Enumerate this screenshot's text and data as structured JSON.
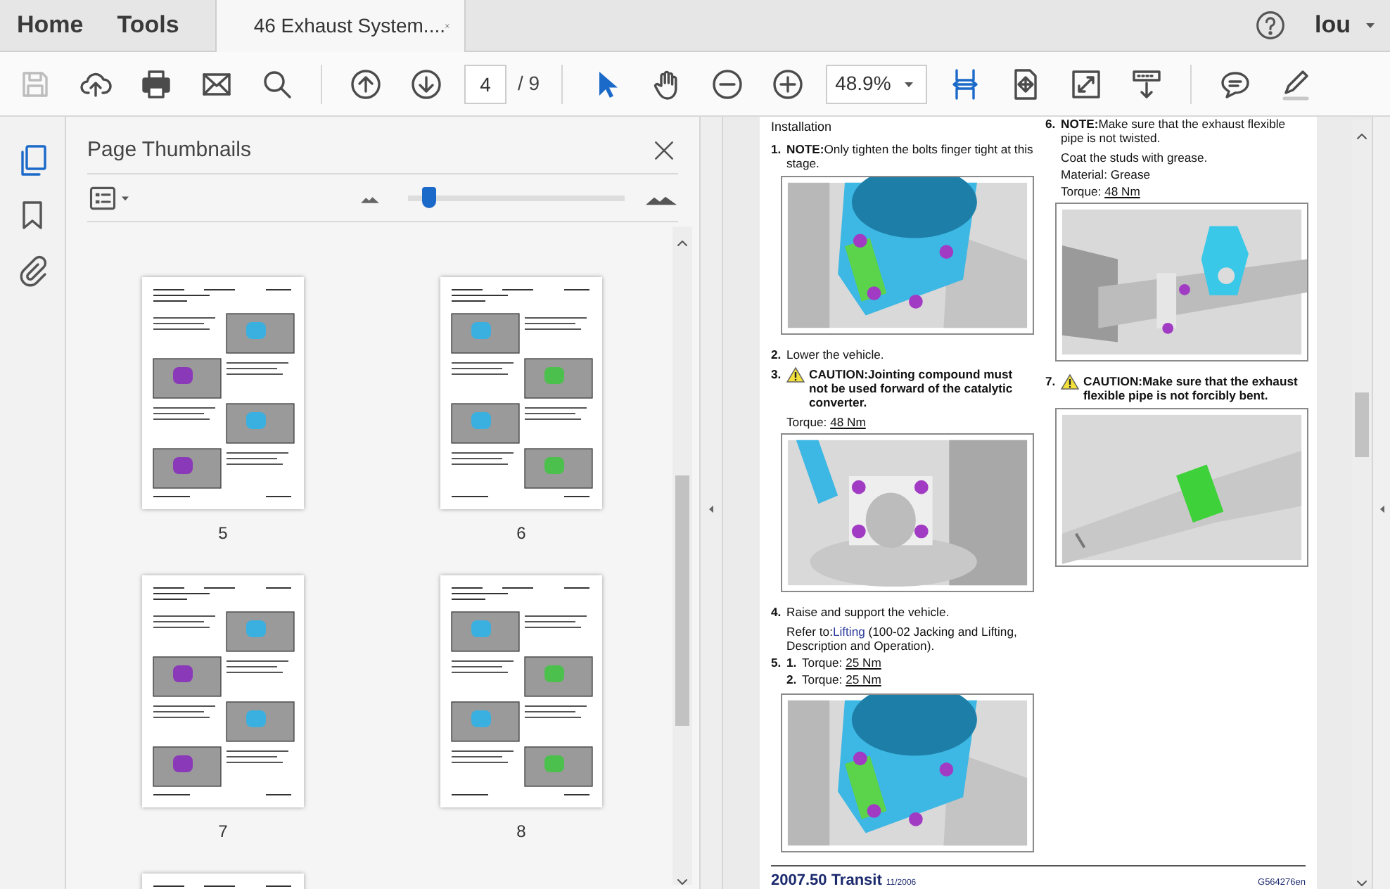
{
  "tabs": [
    {
      "label": "Home",
      "selected": false
    },
    {
      "label": "Tools",
      "selected": false
    },
    {
      "label": "46 Exhaust System....",
      "selected": true
    }
  ],
  "user": "lou",
  "toolbar": [
    {
      "kind": "save",
      "disabled": true,
      "selected": false
    },
    {
      "kind": "upload",
      "disabled": false,
      "selected": false
    },
    {
      "kind": "print",
      "disabled": false,
      "selected": false
    },
    {
      "kind": "mail",
      "disabled": false,
      "selected": false
    },
    {
      "kind": "search",
      "disabled": false,
      "selected": false
    },
    {
      "kind": "separator"
    },
    {
      "kind": "prev-page",
      "disabled": false,
      "selected": false
    },
    {
      "kind": "next-page",
      "disabled": false,
      "selected": false
    },
    {
      "kind": "page-field",
      "value": "4",
      "total": "/ 9"
    },
    {
      "kind": "separator"
    },
    {
      "kind": "select",
      "disabled": false,
      "selected": true
    },
    {
      "kind": "hand",
      "disabled": false,
      "selected": false
    },
    {
      "kind": "zoom-out",
      "disabled": false,
      "selected": false
    },
    {
      "kind": "zoom-in",
      "disabled": false,
      "selected": false
    },
    {
      "kind": "zoom-field",
      "value": "48.9%"
    },
    {
      "kind": "fit-width",
      "disabled": false,
      "selected": true
    },
    {
      "kind": "fit-page",
      "disabled": false,
      "selected": false
    },
    {
      "kind": "full-screen",
      "disabled": false,
      "selected": false
    },
    {
      "kind": "scroll-mode",
      "disabled": false,
      "selected": false
    },
    {
      "kind": "separator"
    },
    {
      "kind": "comment",
      "disabled": false,
      "selected": false
    },
    {
      "kind": "sign",
      "disabled": false,
      "selected": false
    }
  ],
  "rail": [
    {
      "kind": "pages",
      "selected": true
    },
    {
      "kind": "bookmarks",
      "selected": false
    },
    {
      "kind": "attachments",
      "selected": false
    }
  ],
  "panel": {
    "title": "Page Thumbnails",
    "size_slider": {
      "level": 0.1
    },
    "thumbnails": [
      {
        "kind": "page",
        "label": "5"
      },
      {
        "kind": "page",
        "label": "6"
      },
      {
        "kind": "page",
        "label": "7"
      },
      {
        "kind": "page",
        "label": "8"
      },
      {
        "kind": "page"
      }
    ]
  },
  "document": {
    "heading": "Installation",
    "columns": [
      [
        {
          "number": "1.",
          "kind": "note",
          "text": "**NOTE:**Only tighten the bolts finger tight at this stage.",
          "figure": {
            "kind": "picture"
          }
        },
        {
          "number": "2.",
          "kind": "plain",
          "text": "Lower the vehicle."
        },
        {
          "number": "3.",
          "kind": "caution",
          "text": "CAUTION:Jointing compound must not be used forward of the catalytic converter.",
          "lines": [
            {
              "kind": "spec",
              "text": "Torque: ",
              "link": "48 Nm"
            }
          ],
          "figure": {
            "kind": "picture"
          }
        },
        {
          "number": "4.",
          "kind": "plain",
          "text": "Raise and support the vehicle.",
          "lines": [
            {
              "kind": "ref",
              "text": "Refer to:",
              "link": "Lifting",
              "after": " (100-02 Jacking and Lifting, Description and Operation)."
            }
          ]
        },
        {
          "number": "5.",
          "kind": "list",
          "substeps": [
            {
              "number": "1.",
              "text": "Torque: ",
              "link": "25 Nm"
            },
            {
              "number": "2.",
              "text": "Torque: ",
              "link": "25 Nm"
            }
          ],
          "figure": {
            "kind": "picture"
          }
        }
      ],
      [
        {
          "number": "6.",
          "kind": "note",
          "text": "**NOTE:**Make sure that the exhaust flexible pipe is not twisted.",
          "lines": [
            {
              "kind": "plain",
              "text": "Coat the studs with grease."
            },
            {
              "kind": "plain",
              "text": "Material: Grease"
            },
            {
              "kind": "spec",
              "text": "Torque: ",
              "link": "48 Nm"
            }
          ],
          "figure": {
            "kind": "picture"
          }
        },
        {
          "number": "7.",
          "kind": "caution",
          "text": "CAUTION:Make sure that the exhaust flexible pipe is not forcibly bent.",
          "figure": {
            "kind": "picture"
          }
        }
      ]
    ],
    "footer": {
      "model": "2007.50 Transit",
      "date": "11/2006",
      "code": "G564276en"
    }
  }
}
